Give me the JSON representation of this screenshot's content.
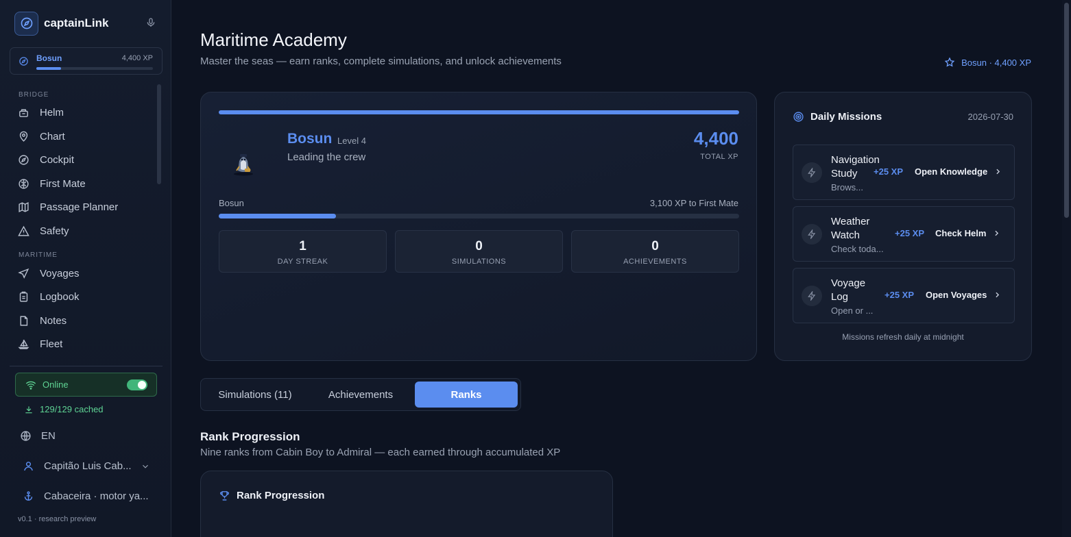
{
  "app": {
    "name": "captainLink"
  },
  "rank_mini": {
    "name": "Bosun",
    "xp": "4,400 XP",
    "progress": 0.21
  },
  "nav": {
    "sections": [
      {
        "title": "BRIDGE",
        "items": [
          {
            "label": "Helm",
            "icon": "helm-icon"
          },
          {
            "label": "Chart",
            "icon": "map-pin-icon"
          },
          {
            "label": "Cockpit",
            "icon": "compass-icon"
          },
          {
            "label": "First Mate",
            "icon": "brain-icon"
          },
          {
            "label": "Passage Planner",
            "icon": "map-icon"
          },
          {
            "label": "Safety",
            "icon": "warning-icon"
          }
        ]
      },
      {
        "title": "MARITIME",
        "items": [
          {
            "label": "Voyages",
            "icon": "navigation-icon"
          },
          {
            "label": "Logbook",
            "icon": "clipboard-icon"
          },
          {
            "label": "Notes",
            "icon": "file-icon"
          },
          {
            "label": "Fleet",
            "icon": "sailboat-icon"
          }
        ]
      }
    ]
  },
  "status": {
    "online_label": "Online",
    "online": true,
    "cached": "129/129 cached"
  },
  "language": "EN",
  "user": {
    "name": "Capitão Luis Cab..."
  },
  "vessel": {
    "name": "Cabaceira · motor ya..."
  },
  "version": "v0.1 · research preview",
  "page": {
    "title": "Maritime Academy",
    "subtitle": "Master the seas — earn ranks, complete simulations, and unlock achievements",
    "badge": "Bosun · 4,400 XP"
  },
  "hero": {
    "rank": "Bosun",
    "level": "Level 4",
    "motto": "Leading the crew",
    "total_xp": "4,400",
    "total_xp_label": "TOTAL XP",
    "progress_from": "Bosun",
    "progress_to": "3,100 XP to First Mate",
    "progress": 0.225,
    "stats": [
      {
        "value": "1",
        "label": "DAY STREAK"
      },
      {
        "value": "0",
        "label": "SIMULATIONS"
      },
      {
        "value": "0",
        "label": "ACHIEVEMENTS"
      }
    ]
  },
  "missions": {
    "title": "Daily Missions",
    "date": "2026-07-30",
    "items": [
      {
        "title": "Navigation Study",
        "desc": "Brows...",
        "xp": "+25 XP",
        "action": "Open Knowledge"
      },
      {
        "title": "Weather Watch",
        "desc": "Check toda...",
        "xp": "+25 XP",
        "action": "Check Helm"
      },
      {
        "title": "Voyage Log",
        "desc": "Open or ...",
        "xp": "+25 XP",
        "action": "Open Voyages"
      }
    ],
    "footer": "Missions refresh daily at midnight"
  },
  "tabs": [
    {
      "label": "Simulations (11)",
      "active": false
    },
    {
      "label": "Achievements",
      "active": false
    },
    {
      "label": "Ranks",
      "active": true
    }
  ],
  "ranks_section": {
    "title": "Rank Progression",
    "subtitle": "Nine ranks from Cabin Boy to Admiral — each earned through accumulated XP",
    "card_title": "Rank Progression"
  }
}
